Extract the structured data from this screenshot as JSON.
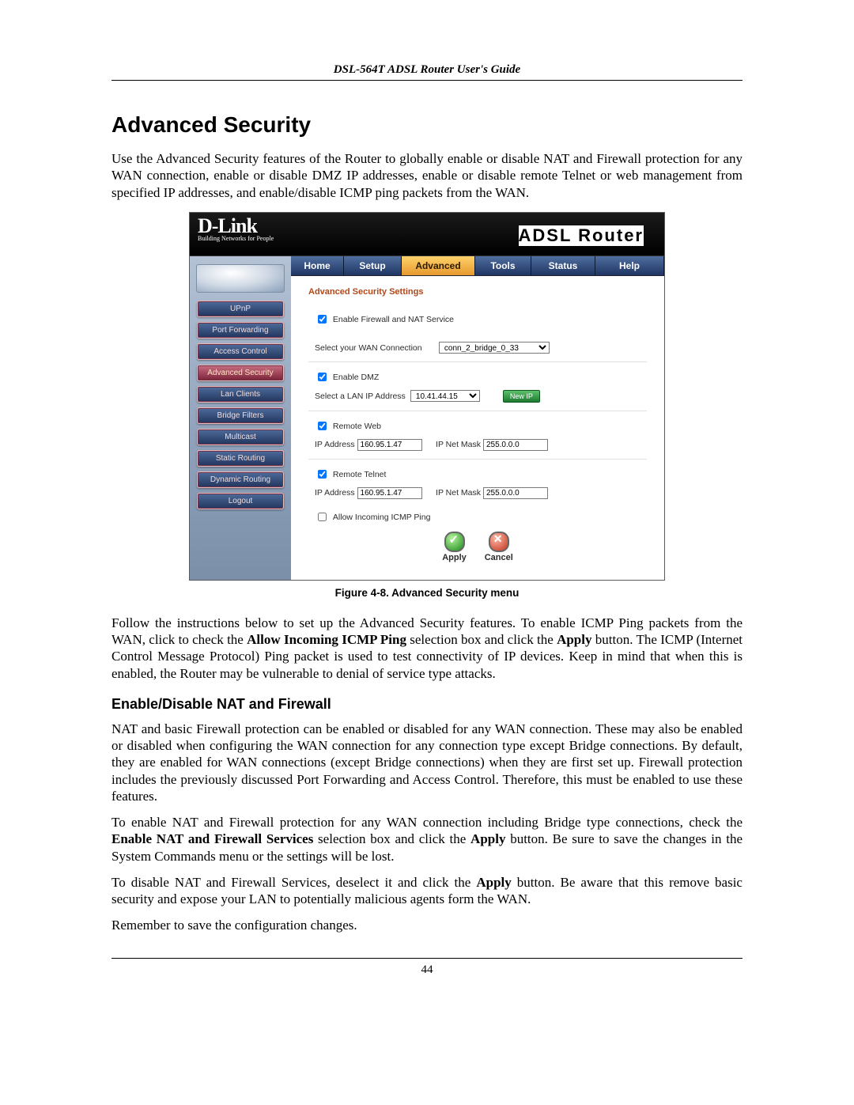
{
  "running_head": "DSL-564T ADSL Router User's Guide",
  "title": "Advanced Security",
  "intro": "Use the Advanced Security features of the Router to globally enable or disable NAT and Firewall protection for any WAN connection, enable or disable DMZ IP addresses, enable or disable remote Telnet or web management from specified IP addresses, and enable/disable ICMP ping packets from the WAN.",
  "brand_name": "D-Link",
  "brand_tag": "Building Networks for People",
  "header_right": "ADSL Router",
  "topnav": {
    "home": "Home",
    "setup": "Setup",
    "advanced": "Advanced",
    "tools": "Tools",
    "status": "Status",
    "help": "Help"
  },
  "sidebar": {
    "items": [
      "UPnP",
      "Port Forwarding",
      "Access Control",
      "Advanced Security",
      "Lan Clients",
      "Bridge Filters",
      "Multicast",
      "Static Routing",
      "Dynamic Routing",
      "Logout"
    ]
  },
  "panel": {
    "title": "Advanced Security Settings",
    "enable_fw_label": "Enable Firewall and NAT Service",
    "wan_conn_label": "Select your WAN Connection",
    "wan_conn_value": "conn_2_bridge_0_33",
    "enable_dmz_label": "Enable DMZ",
    "dmz_lanip_label": "Select a LAN IP Address",
    "dmz_lanip_value": "10.41.44.15",
    "new_btn": "New IP",
    "remote_web_label": "Remote Web",
    "remote_web_ip_label": "IP Address",
    "remote_web_ip": "160.95.1.47",
    "remote_web_mask_label": "IP Net Mask",
    "remote_web_mask": "255.0.0.0",
    "remote_telnet_label": "Remote Telnet",
    "remote_telnet_ip_label": "IP Address",
    "remote_telnet_ip": "160.95.1.47",
    "remote_telnet_mask_label": "IP Net Mask",
    "remote_telnet_mask": "255.0.0.0",
    "icmp_label": "Allow Incoming ICMP Ping",
    "apply": "Apply",
    "cancel": "Cancel"
  },
  "fig_caption": "Figure 4-8. Advanced Security menu",
  "para_follow_a": "Follow the instructions below to set up the Advanced Security features. To enable ICMP Ping packets from the WAN, click to check the ",
  "para_follow_b1": "Allow Incoming ICMP Ping",
  "para_follow_c": " selection box and click the ",
  "para_follow_b2": "Apply",
  "para_follow_d": " button. The ICMP (Internet Control Message Protocol) Ping packet is used to test connectivity of IP devices. Keep in mind that when this is enabled, the Router may be vulnerable to denial of service type attacks.",
  "sub_heading": "Enable/Disable NAT and Firewall",
  "para_nat1": "NAT and basic Firewall protection can be enabled or disabled for any WAN connection. These may also be enabled or disabled when configuring the WAN connection for any connection type except Bridge connections. By default, they are enabled for WAN connections (except Bridge connections) when they are first set up. Firewall protection includes the previously discussed Port Forwarding and Access Control. Therefore, this must be enabled to use these features.",
  "para_nat2_a": "To enable NAT and Firewall protection for any WAN connection including Bridge type connections, check the ",
  "para_nat2_b1": "Enable NAT and Firewall Services",
  "para_nat2_c": " selection box and click the ",
  "para_nat2_b2": "Apply",
  "para_nat2_d": " button. Be sure to save the changes in the System Commands menu or the settings will be lost.",
  "para_nat3_a": "To disable NAT and Firewall Services, deselect it and click the ",
  "para_nat3_b": "Apply",
  "para_nat3_c": " button. Be aware that this remove basic security and expose your LAN to potentially malicious agents form the WAN.",
  "para_remember": "Remember to save the configuration changes.",
  "page_number": "44"
}
